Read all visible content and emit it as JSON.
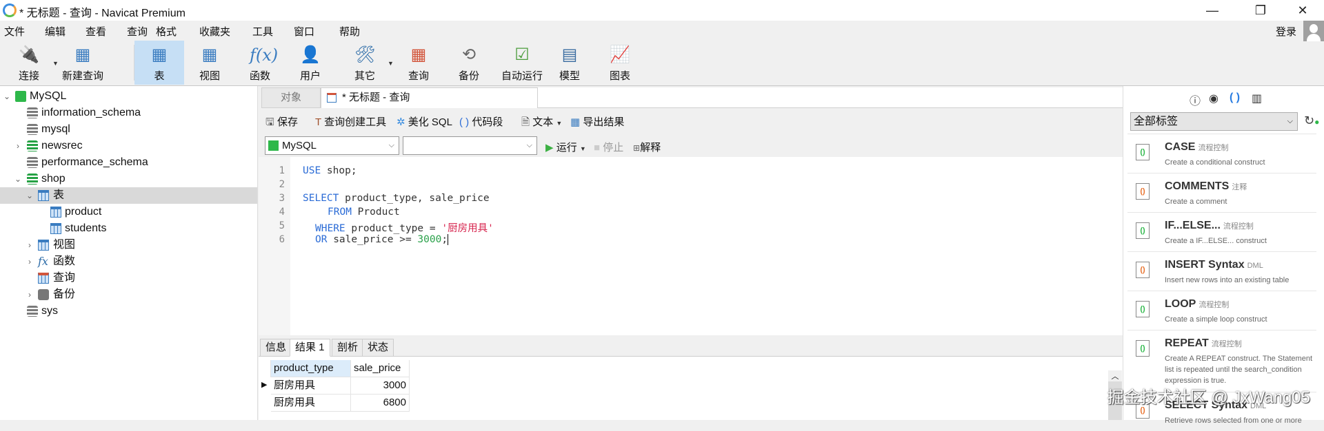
{
  "window": {
    "title": "* 无标题 - 查询 - Navicat Premium",
    "minimize": "—",
    "maximize": "❐",
    "close": "✕"
  },
  "menu": [
    "文件",
    "编辑",
    "查看",
    "查询",
    "格式",
    "收藏夹",
    "工具",
    "窗口",
    "帮助"
  ],
  "login": "登录",
  "toolbar": [
    {
      "label": "连接",
      "icon": "plug-icon"
    },
    {
      "label": "新建查询",
      "icon": "new-query-icon"
    },
    {
      "label": "表",
      "icon": "table-icon"
    },
    {
      "label": "视图",
      "icon": "view-icon"
    },
    {
      "label": "函数",
      "icon": "function-icon"
    },
    {
      "label": "用户",
      "icon": "user-icon"
    },
    {
      "label": "其它",
      "icon": "tools-icon"
    },
    {
      "label": "查询",
      "icon": "query-icon"
    },
    {
      "label": "备份",
      "icon": "backup-icon"
    },
    {
      "label": "自动运行",
      "icon": "schedule-icon"
    },
    {
      "label": "模型",
      "icon": "model-icon"
    },
    {
      "label": "图表",
      "icon": "chart-icon"
    }
  ],
  "tree": [
    "MySQL",
    "information_schema",
    "mysql",
    "newsrec",
    "performance_schema",
    "shop",
    "表",
    "product",
    "students",
    "视图",
    "函数",
    "查询",
    "备份",
    "sys"
  ],
  "tabs": {
    "objects": "对象",
    "query": "* 无标题 - 查询"
  },
  "querybar": {
    "save": "保存",
    "builder": "查询创建工具",
    "beautify": "美化 SQL",
    "snippet": "代码段",
    "text": "文本",
    "export": "导出结果"
  },
  "connection": "MySQL",
  "database": "",
  "run": {
    "run": "运行",
    "stop": "停止",
    "explain": "解释"
  },
  "editor": {
    "l1a": "USE",
    "l1b": " shop;",
    "l3a": "SELECT",
    "l3b": " product_type, sale_price",
    "l4a": "FROM",
    "l4b": " Product",
    "l5a": "WHERE",
    "l5b": " product_type = ",
    "l5c": "'厨房用具'",
    "l6a": "OR",
    "l6b": " sale_price >= ",
    "l6c": "3000",
    "l6d": ";"
  },
  "result_tabs": [
    "信息",
    "结果 1",
    "剖析",
    "状态"
  ],
  "grid": {
    "columns": [
      "product_type",
      "sale_price"
    ],
    "rows": [
      [
        "厨房用具",
        "3000"
      ],
      [
        "厨房用具",
        "6800"
      ]
    ]
  },
  "right": {
    "tag_filter": "全部标签",
    "snippets": [
      {
        "name": "CASE",
        "cat": "流程控制",
        "desc": "Create a conditional construct"
      },
      {
        "name": "COMMENTS",
        "cat": "注释",
        "desc": "Create a comment"
      },
      {
        "name": "IF...ELSE...",
        "cat": "流程控制",
        "desc": "Create a IF...ELSE... construct"
      },
      {
        "name": "INSERT Syntax",
        "cat": "DML",
        "desc": "Insert new rows into an existing table"
      },
      {
        "name": "LOOP",
        "cat": "流程控制",
        "desc": "Create a simple loop construct"
      },
      {
        "name": "REPEAT",
        "cat": "流程控制",
        "desc": "Create A REPEAT construct. The Statement list is repeated until the search_condition expression is true."
      },
      {
        "name": "SELECT Syntax",
        "cat": "DML",
        "desc": "Retrieve rows selected from one or more"
      }
    ]
  },
  "watermark": "掘金技术社区 @ JxWang05"
}
